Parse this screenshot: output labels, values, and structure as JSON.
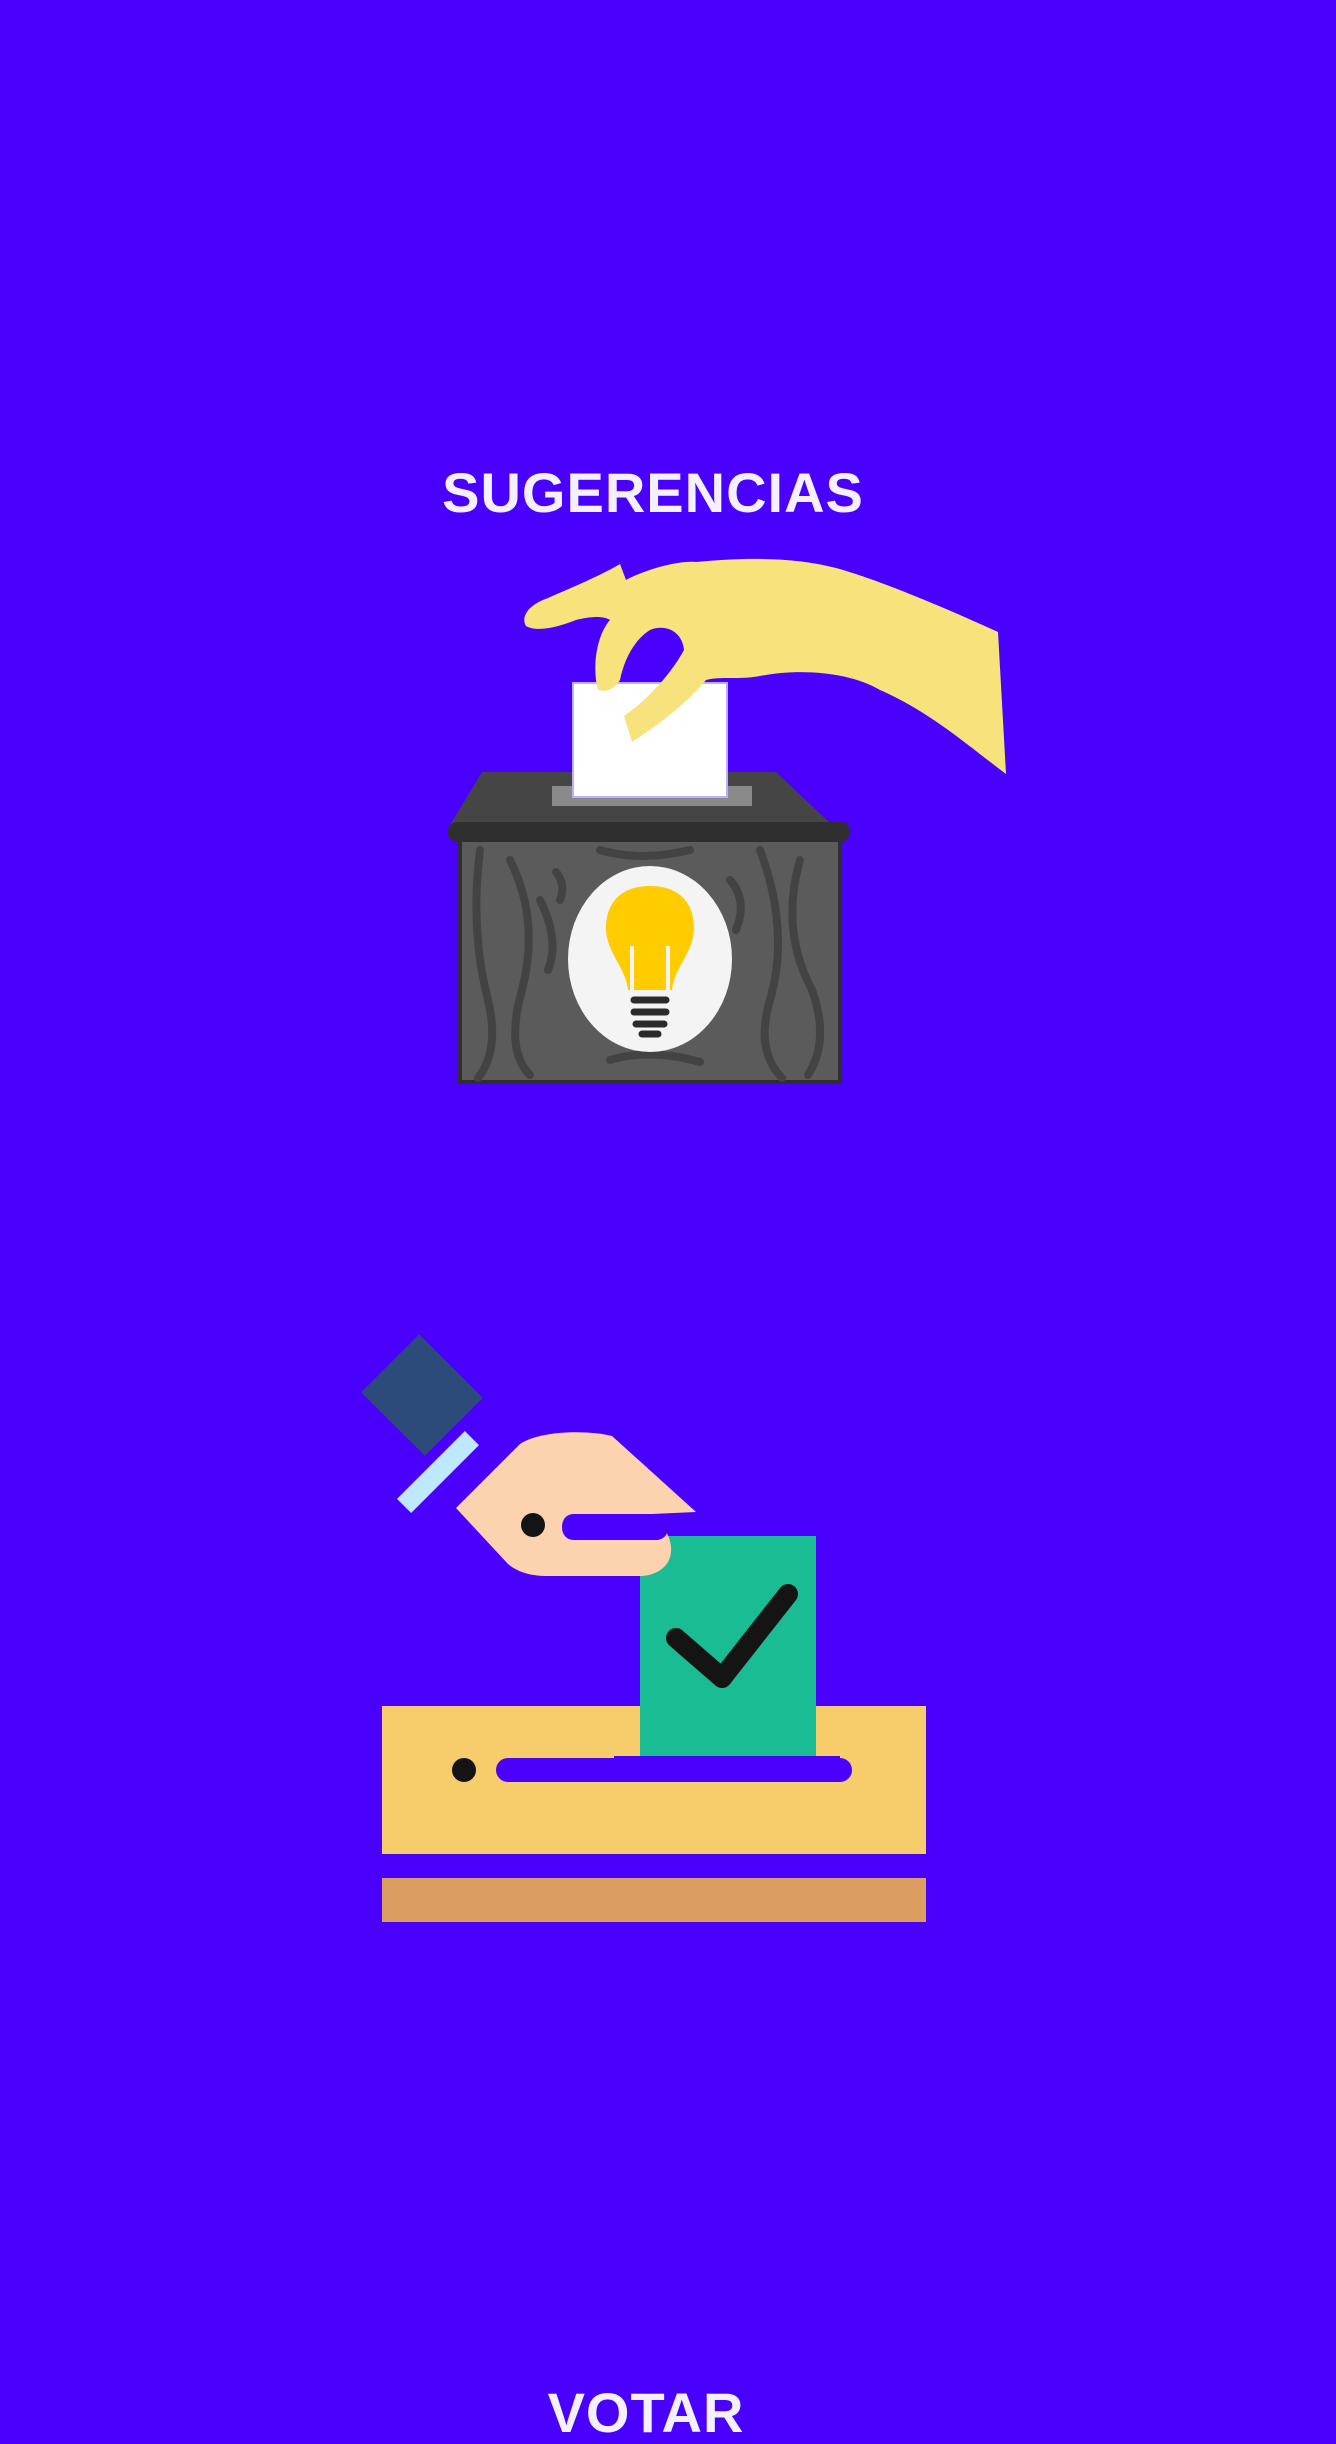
{
  "menu": {
    "suggestions": {
      "label": "SUGERENCIAS",
      "icon": "suggestion-box-lightbulb-icon"
    },
    "vote": {
      "label": "VOTAR",
      "icon": "ballot-box-vote-icon"
    }
  },
  "colors": {
    "background": "#4a00fd",
    "title_text": "#f3f0ff",
    "hand_yellow": "#f7e27c",
    "box_dark": "#565656",
    "bulb_yellow": "#ffcc00",
    "ballot_green": "#1abc94",
    "box_orange": "#f7cd6c",
    "base_brown": "#dc9e60",
    "skin": "#fcd3ae",
    "sleeve": "#2d4b7a"
  }
}
